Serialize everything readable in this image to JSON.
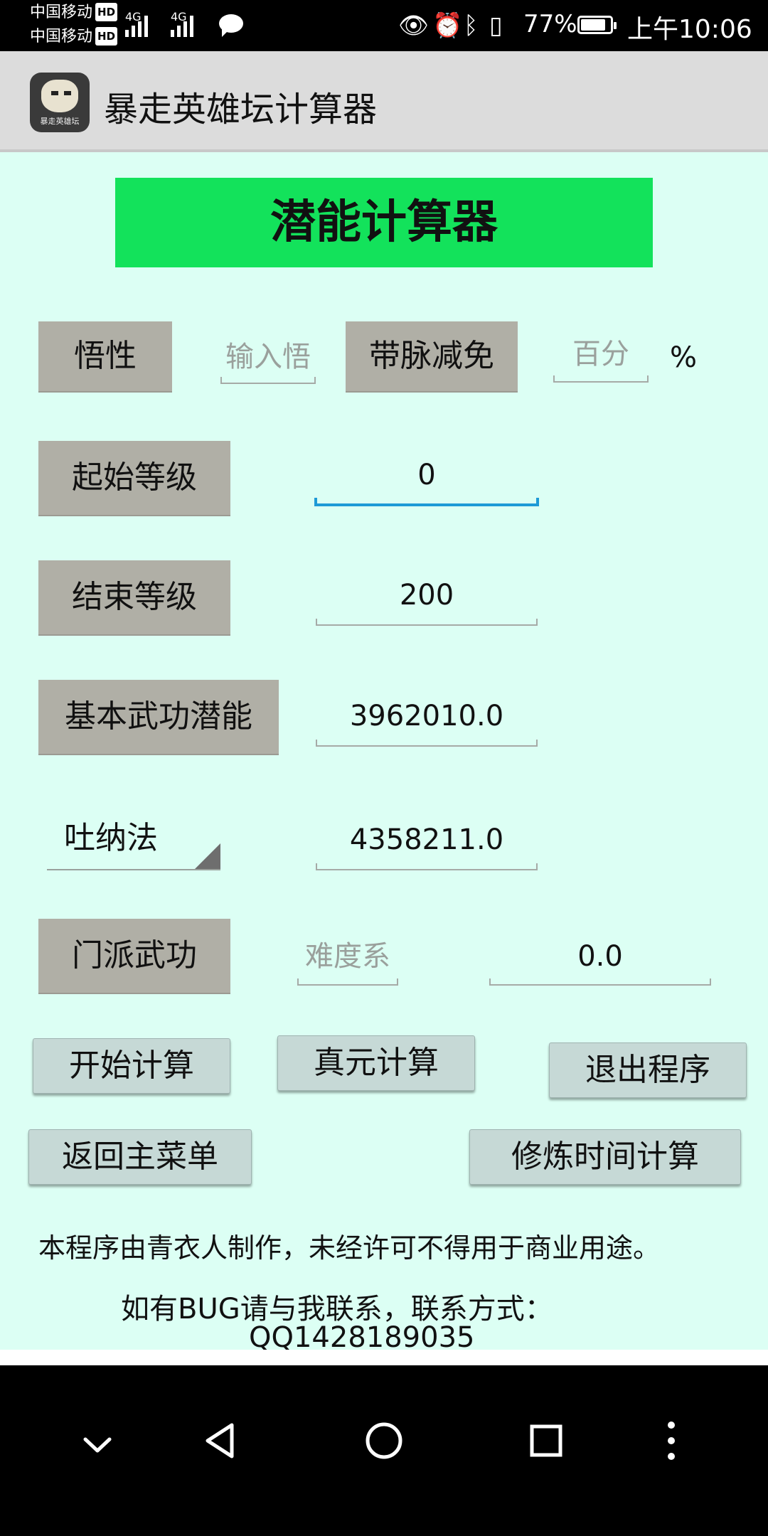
{
  "status_bar": {
    "carrier1": "中国移动",
    "carrier2": "中国移动",
    "hd_label": "HD",
    "net1": "4G",
    "net2": "4G",
    "battery": "77%",
    "time": "上午10:06"
  },
  "app_bar": {
    "title": "暴走英雄坛计算器",
    "logo_caption": "暴走英雄坛"
  },
  "header": {
    "title": "潜能计算器"
  },
  "form": {
    "wuxing_button": "悟性",
    "wuxing_placeholder": "输入悟",
    "daimai_button": "带脉减免",
    "daimai_placeholder": "百分",
    "percent_sign": "%",
    "start_level_button": "起始等级",
    "start_level_value": "0",
    "end_level_button": "结束等级",
    "end_level_value": "200",
    "base_potential_button": "基本武功潜能",
    "base_potential_value": "3962010.0",
    "technique_selected": "吐纳法",
    "technique_value": "4358211.0",
    "sect_button": "门派武功",
    "difficulty_placeholder": "难度系",
    "sect_value": "0.0"
  },
  "actions": {
    "start_calc": "开始计算",
    "zhenyuan_calc": "真元计算",
    "exit": "退出程序",
    "main_menu": "返回主菜单",
    "training_time": "修炼时间计算"
  },
  "footer": {
    "line1": "本程序由青衣人制作，未经许可不得用于商业用途。",
    "line2": "如有BUG请与我联系，联系方式：",
    "line3": "QQ1428189035"
  },
  "colors": {
    "content_bg": "#dcfff4",
    "banner_green": "#13e25b",
    "label_gray": "#b0afa6",
    "action_button": "#c6d9d6",
    "focus_blue": "#1e9ad6"
  }
}
